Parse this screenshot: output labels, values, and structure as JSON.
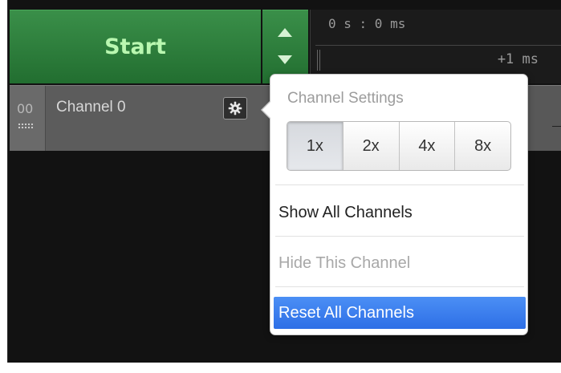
{
  "controls": {
    "start_label": "Start"
  },
  "timeline": {
    "origin_label": "0 s : 0 ms",
    "offset_label": "+1 ms"
  },
  "channel": {
    "index": "00",
    "name": "Channel 0"
  },
  "icons": {
    "settings": "gear-icon",
    "grip": "grip-icon",
    "increment": "arrow-up-icon",
    "decrement": "arrow-down-icon"
  },
  "popover": {
    "title": "Channel Settings",
    "zoom_options": [
      "1x",
      "2x",
      "4x",
      "8x"
    ],
    "selected_zoom": "1x",
    "menu": [
      {
        "label": "Show All Channels",
        "enabled": true
      },
      {
        "label": "Hide This Channel",
        "enabled": false
      },
      {
        "label": "Reset All Channels",
        "enabled": true,
        "highlighted": true
      }
    ]
  },
  "colors": {
    "start_green": "#2f7f3d",
    "start_text": "#b9f7b0",
    "highlight_blue": "#3a7ef0"
  }
}
